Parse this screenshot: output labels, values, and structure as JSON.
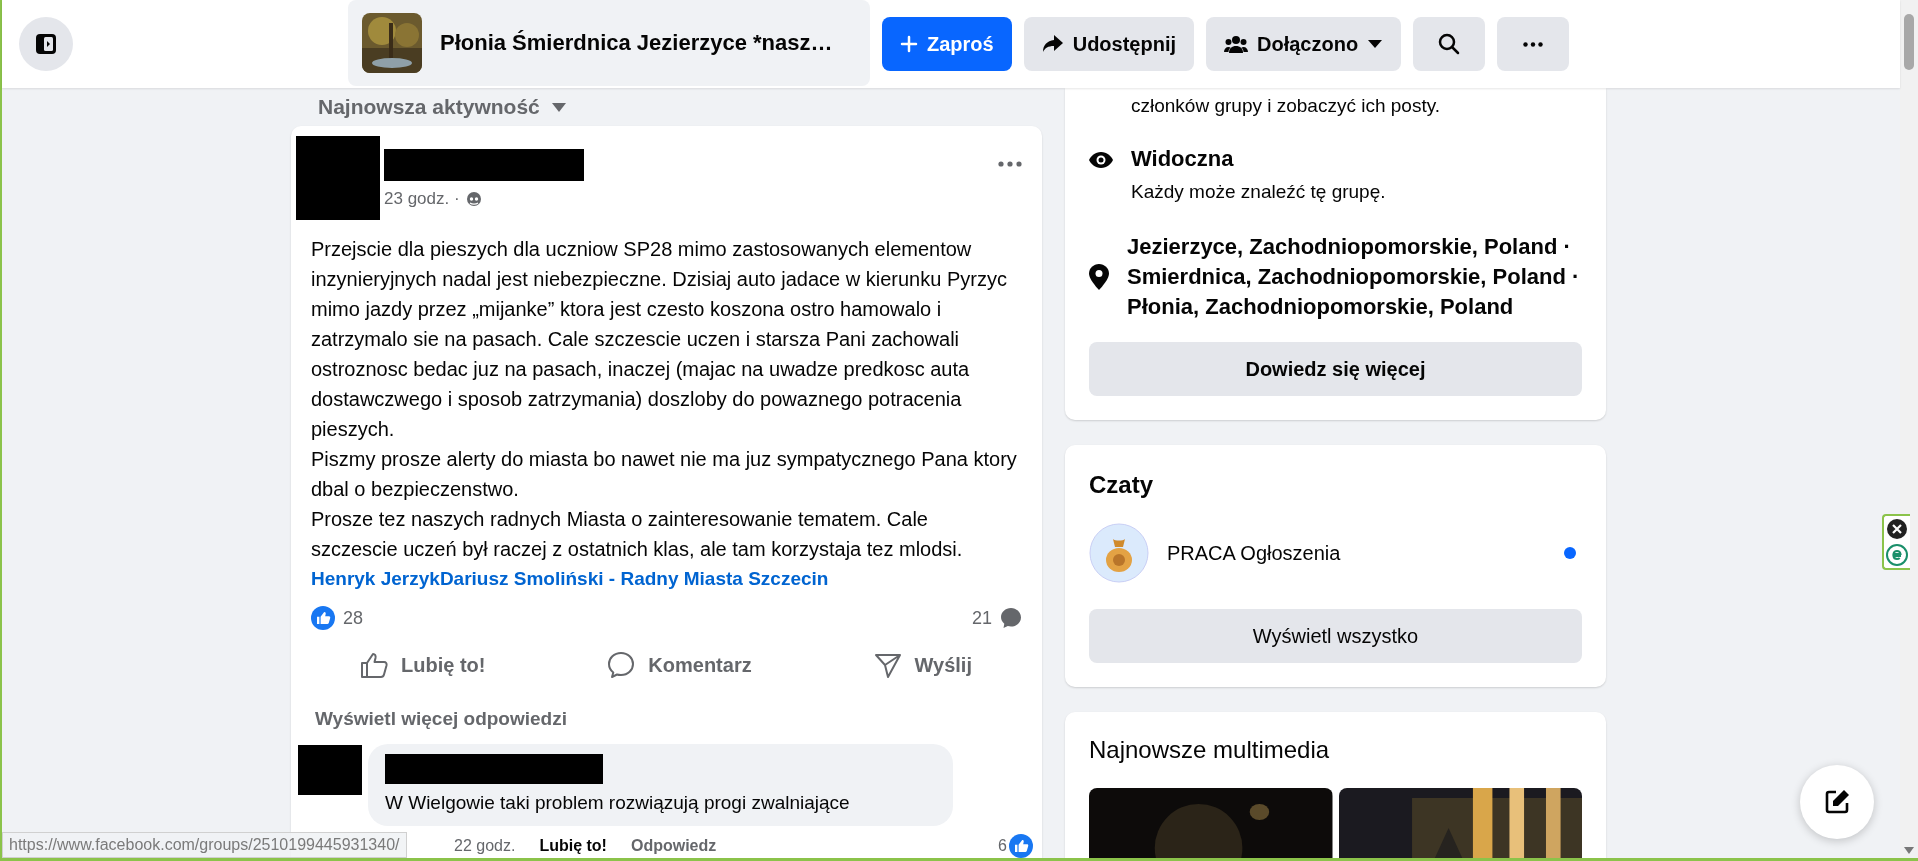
{
  "top_bar": {
    "group_title": "Płonia Śmierdnica Jezierzyce *nasz…",
    "buttons": [
      {
        "label": "Zaproś",
        "kind": "invite"
      },
      {
        "label": "Udostępnij",
        "kind": "share"
      },
      {
        "label": "Dołączono",
        "kind": "joined"
      }
    ]
  },
  "feed": {
    "sort_label": "Najnowsza aktywność",
    "post": {
      "time": "23 godz. ·",
      "paragraphs": [
        "Przejscie dla pieszych dla uczniow SP28 mimo zastosowanych elementow inzynieryjnych nadal jest niebezpieczne. Dzisiaj auto jadace w kierunku Pyrzyc mimo jazdy przez „mijanke” ktora jest czesto koszona ostro hamowalo i zatrzymalo sie na pasach. Cale szczescie uczen i starsza Pani zachowali ostroznosc bedac juz na pasach, inaczej (majac na uwadze predkosc auta dostawczwego i sposob zatrzymania) doszloby do powaznego potracenia pieszych.",
        "Piszmy prosze alerty do miasta bo nawet nie ma juz sympatycznego Pana ktory dbal o bezpieczenstwo.",
        "Prosze tez naszych radnych Miasta o zainteresowanie tematem. Cale szczescie uczeń był raczej z ostatnich klas, ale tam korzystaja tez mlodsi."
      ],
      "mentions": [
        "Henryk Jerzyk",
        "Dariusz Smoliński - Radny Miasta Szczecin"
      ],
      "likes": "28",
      "comments": "21",
      "actions": [
        {
          "label": "Lubię to!",
          "kind": "like"
        },
        {
          "label": "Komentarz",
          "kind": "comment"
        },
        {
          "label": "Wyślij",
          "kind": "send"
        }
      ],
      "more_replies": "Wyświetl więcej odpowiedzi",
      "comment": {
        "text": "W Wielgowie taki problem rozwiązują progi zwalniające",
        "time": "22 godz.",
        "like": "Lubię to!",
        "reply": "Odpowiedz",
        "likes": "6"
      }
    }
  },
  "sidebar": {
    "about": {
      "partial_text": "członków grupy i zobaczyć ich posty.",
      "items": [
        {
          "kind": "visibility",
          "title": "Widoczna",
          "text": "Każdy może znaleźć tę grupę."
        },
        {
          "kind": "location",
          "title": "Jezierzyce, Zachodniopomorskie, Poland · Smierdnica, Zachodniopomorskie, Poland · Płonia, Zachodniopomorskie, Poland"
        }
      ],
      "button": "Dowiedz się więcej"
    },
    "chats": {
      "title": "Czaty",
      "items": [
        {
          "name": "PRACA Ogłoszenia",
          "unread": true
        }
      ],
      "button": "Wyświetl wszystko"
    },
    "media": {
      "title": "Najnowsze multimedia"
    }
  },
  "status_bar": {
    "url": "https://www.facebook.com/groups/2510199445931340/"
  }
}
